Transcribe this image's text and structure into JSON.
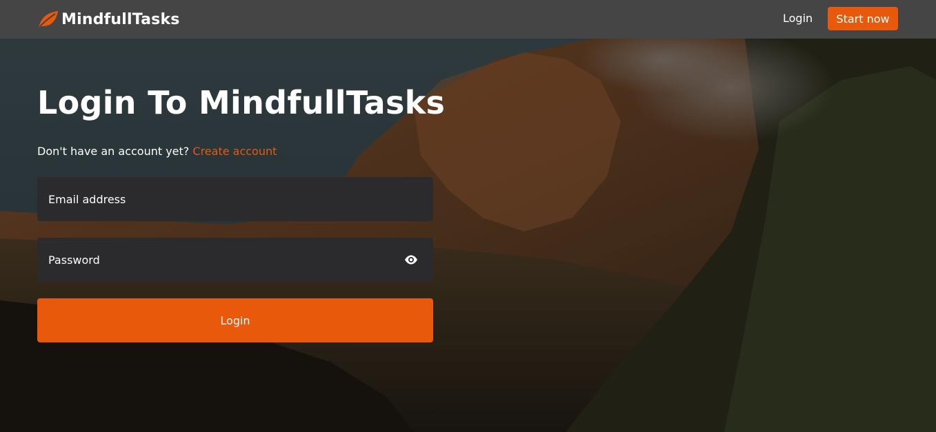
{
  "nav": {
    "brand": "MindfullTasks",
    "login_label": "Login",
    "start_label": "Start now"
  },
  "main": {
    "title": "Login To MindfullTasks",
    "signup_prompt": "Don't have an account yet?",
    "signup_link": "Create account",
    "email_placeholder": "Email address",
    "password_placeholder": "Password",
    "submit_label": "Login"
  },
  "icons": {
    "brand": "leaf-icon",
    "password_toggle": "eye-icon"
  },
  "colors": {
    "accent": "#e8590c",
    "navbar": "#454545",
    "field_bg": "#2b2b2d"
  }
}
